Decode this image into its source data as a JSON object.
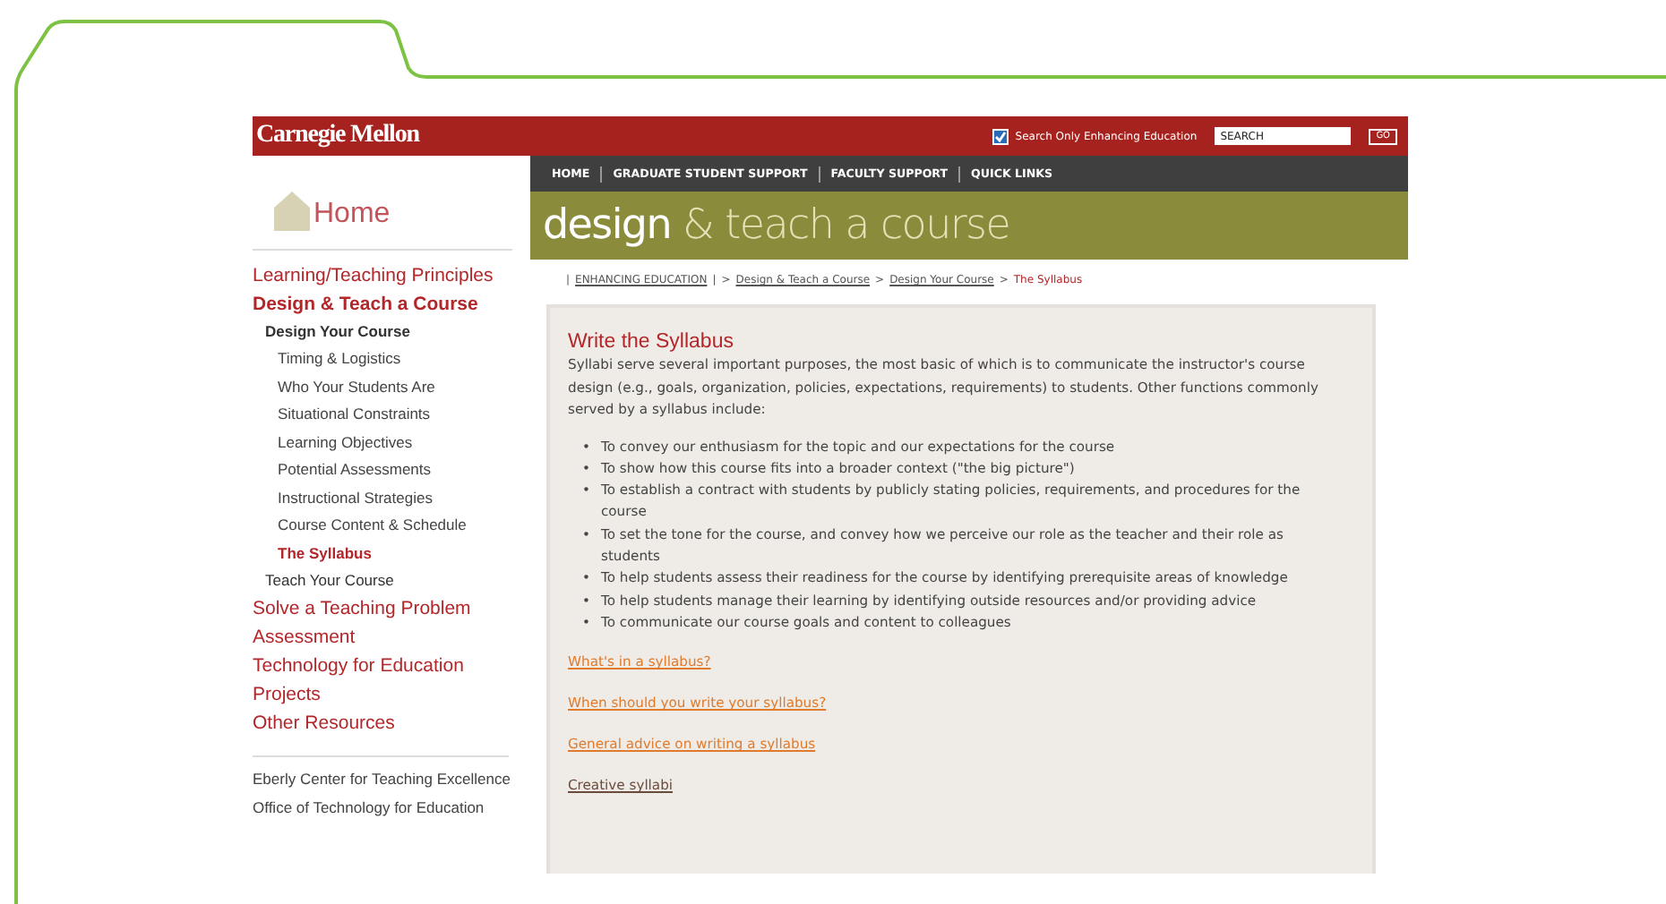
{
  "header": {
    "logo": "Carnegie Mellon",
    "search_scope": {
      "label": "Search Only Enhancing Education",
      "checked": true
    },
    "search": {
      "placeholder": "SEARCH"
    },
    "go_button": "GO"
  },
  "nav": [
    {
      "label": "HOME"
    },
    {
      "label": "GRADUATE STUDENT SUPPORT"
    },
    {
      "label": "FACULTY SUPPORT"
    },
    {
      "label": "QUICK LINKS"
    }
  ],
  "home_link": "Home",
  "banner": {
    "title_main": "design",
    "title_rest": "& teach a course"
  },
  "sidebar": {
    "items": [
      {
        "label": "Learning/Teaching Principles",
        "selected": false
      },
      {
        "label": "Design & Teach a Course",
        "selected": true,
        "children": [
          {
            "label": "Design Your Course",
            "selected": true,
            "children": [
              {
                "label": "Timing & Logistics",
                "selected": false
              },
              {
                "label": "Who Your Students Are",
                "selected": false
              },
              {
                "label": "Situational Constraints",
                "selected": false
              },
              {
                "label": "Learning Objectives",
                "selected": false
              },
              {
                "label": "Potential Assessments",
                "selected": false
              },
              {
                "label": "Instructional Strategies",
                "selected": false
              },
              {
                "label": "Course Content & Schedule",
                "selected": false
              },
              {
                "label": "The Syllabus",
                "selected": true
              }
            ]
          },
          {
            "label": "Teach Your Course",
            "selected": false
          }
        ]
      },
      {
        "label": "Solve a Teaching Problem",
        "selected": false
      },
      {
        "label": "Assessment",
        "selected": false
      },
      {
        "label": "Technology for Education",
        "selected": false
      },
      {
        "label": "Projects",
        "selected": false
      },
      {
        "label": "Other Resources",
        "selected": false
      }
    ],
    "footer_links": [
      "Eberly Center for Teaching Excellence",
      "Office of Technology for Education"
    ]
  },
  "breadcrumb": [
    {
      "label": "|",
      "kind": "text"
    },
    {
      "label": "ENHANCING EDUCATION",
      "kind": "link"
    },
    {
      "label": "|",
      "kind": "text"
    },
    {
      "label": ">",
      "kind": "text"
    },
    {
      "label": "Design & Teach a Course",
      "kind": "link"
    },
    {
      "label": ">",
      "kind": "text"
    },
    {
      "label": "Design Your Course",
      "kind": "link"
    },
    {
      "label": ">",
      "kind": "text"
    },
    {
      "label": "The Syllabus",
      "kind": "current"
    }
  ],
  "article": {
    "title": "Write the Syllabus",
    "intro": "Syllabi serve several important purposes, the most basic of which is to communicate the instructor's course design (e.g., goals, organization, policies, expectations, requirements) to students. Other functions commonly served by a syllabus include:",
    "bullet": "•",
    "bullets": [
      "To convey our enthusiasm for the topic and our expectations for the course",
      "To show how this course fits into a broader context (\"the big picture\")",
      "To establish a contract with students by publicly stating policies, requirements, and procedures for the course",
      "To set the tone for the course, and convey how we perceive our role as the teacher and their role  as students",
      "To help students assess their readiness for the course by identifying prerequisite areas of knowledge",
      "To help students manage their learning by identifying outside resources and/or providing advice",
      "To communicate our course goals and content to colleagues"
    ],
    "links": [
      {
        "label": "What's in a syllabus?",
        "visited": false
      },
      {
        "label": "When should you write your syllabus?",
        "visited": false
      },
      {
        "label": "General advice on writing a syllabus",
        "visited": false
      },
      {
        "label": "Creative syllabi",
        "visited": true
      }
    ]
  }
}
